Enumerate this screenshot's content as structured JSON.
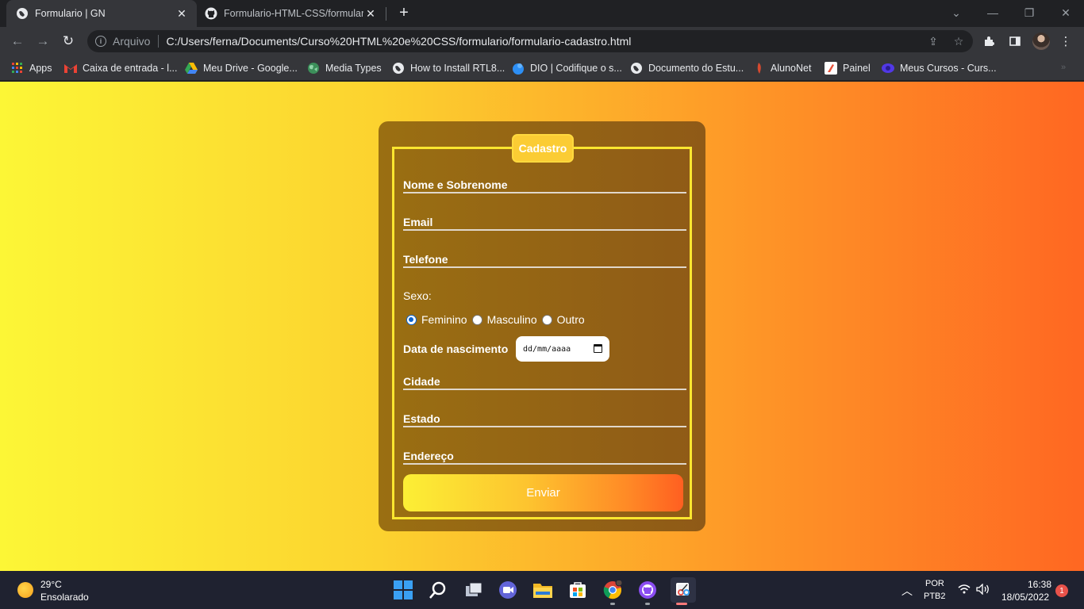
{
  "browser": {
    "tabs": [
      {
        "title": "Formulario | GN",
        "favicon": "globe-icon",
        "active": true
      },
      {
        "title": "Formulario-HTML-CSS/formulario",
        "favicon": "github-icon",
        "active": false
      }
    ],
    "address": {
      "scheme_label": "Arquivo",
      "url": "C:/Users/ferna/Documents/Curso%20HTML%20e%20CSS/formulario/formulario-cadastro.html"
    },
    "bookmarks": [
      {
        "label": "Apps",
        "icon": "apps-grid-icon"
      },
      {
        "label": "Caixa de entrada - l...",
        "icon": "gmail-icon"
      },
      {
        "label": "Meu Drive - Google...",
        "icon": "drive-icon"
      },
      {
        "label": "Media Types",
        "icon": "globe-icon"
      },
      {
        "label": "How to Install RTL8...",
        "icon": "globe-icon"
      },
      {
        "label": "DIO | Codifique o s...",
        "icon": "dio-icon"
      },
      {
        "label": "Documento do Estu...",
        "icon": "globe-icon"
      },
      {
        "label": "AlunoNet",
        "icon": "alunonet-icon"
      },
      {
        "label": "Painel",
        "icon": "painel-icon"
      },
      {
        "label": "Meus Cursos - Curs...",
        "icon": "cursos-icon"
      }
    ],
    "more_bookmarks": "»"
  },
  "form": {
    "legend": "Cadastro",
    "fields": {
      "nome": "Nome e Sobrenome",
      "email": "Email",
      "telefone": "Telefone",
      "cidade": "Cidade",
      "estado": "Estado",
      "endereco": "Endereço"
    },
    "sexo_label": "Sexo:",
    "sexo_options": [
      "Feminino",
      "Masculino",
      "Outro"
    ],
    "sexo_selected": "Feminino",
    "birth_label": "Data de nascimento",
    "birth_placeholder": "dd/mm/aaaa",
    "submit_label": "Enviar"
  },
  "colors": {
    "gradient_start": "#fcf636",
    "gradient_end": "#ff6722",
    "card": "#946113",
    "border": "#fbe62f"
  },
  "taskbar": {
    "weather": {
      "temp": "29°C",
      "desc": "Ensolarado"
    },
    "language": {
      "line1": "POR",
      "line2": "PTB2"
    },
    "clock": {
      "time": "16:38",
      "date": "18/05/2022"
    },
    "notifications": "1"
  }
}
